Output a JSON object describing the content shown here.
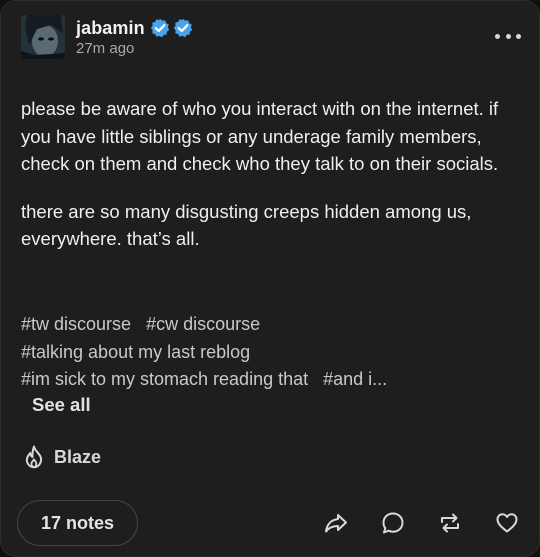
{
  "post": {
    "username": "jabamin",
    "timestamp": "27m ago",
    "body": [
      "please be aware of who you interact with on the internet. if you have little siblings or any underage family members, check on them and check who they talk to on their socials.",
      "there are so many disgusting creeps hidden among us, everywhere. that’s all."
    ],
    "tags": [
      "#tw discourse",
      "#cw discourse",
      "#talking about my last reblog",
      "#im sick to my stomach reading that",
      "#and i..."
    ],
    "see_all_label": "See all"
  },
  "blaze": {
    "label": "Blaze"
  },
  "footer": {
    "notes_label": "17 notes",
    "actions": [
      "share-icon",
      "reply-icon",
      "reblog-icon",
      "like-icon"
    ]
  },
  "colors": {
    "card_bg": "#1e1e1e",
    "verified_blue": "#4aa3e8",
    "text_primary": "#efefef",
    "text_muted": "#a9a9a9"
  }
}
